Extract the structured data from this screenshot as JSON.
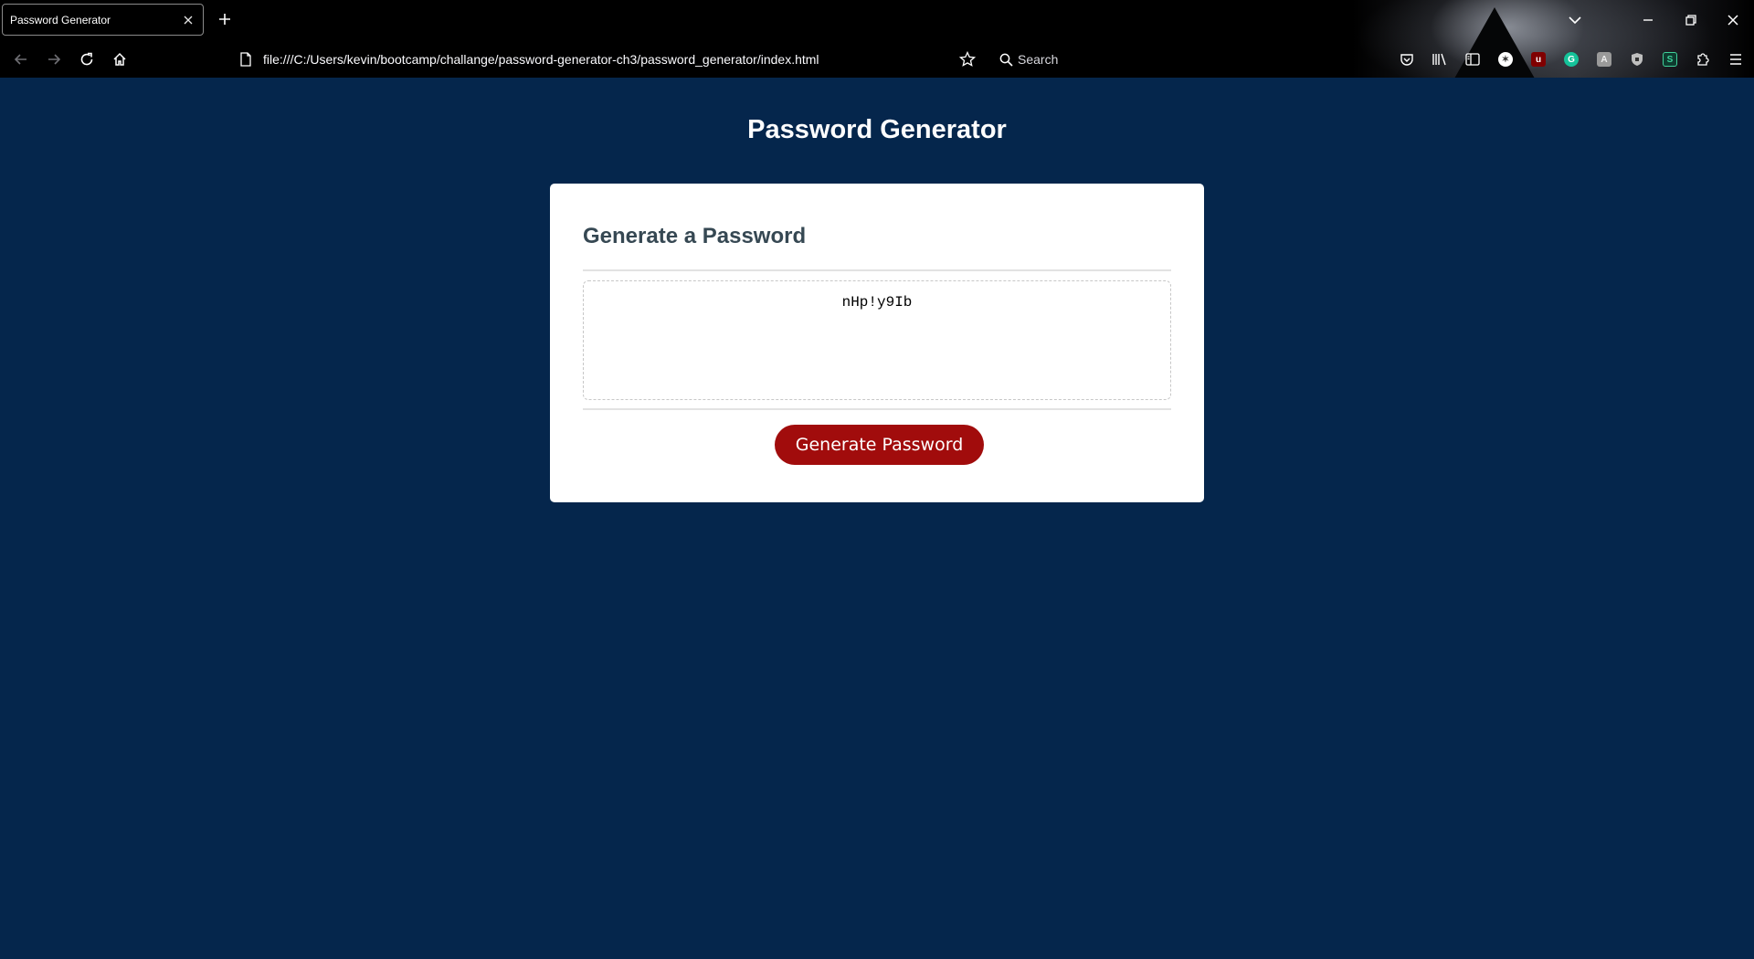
{
  "browser": {
    "tab": {
      "title": "Password Generator"
    },
    "url": "file:///C:/Users/kevin/bootcamp/challange/password-generator-ch3/password_generator/index.html",
    "search": {
      "placeholder": "Search"
    },
    "colors": {
      "chrome_bg": "#000000",
      "chrome_text": "#fbfbfe"
    },
    "icons": {
      "tab_close": "close-icon",
      "new_tab": "plus-icon",
      "list_tabs": "chevron-down-icon",
      "back": "arrow-left-icon",
      "forward": "arrow-right-icon",
      "reload": "reload-icon",
      "home": "home-icon",
      "page": "page-icon",
      "bookmark": "star-icon",
      "search": "search-icon",
      "toolbar": [
        "pocket-icon",
        "library-icon",
        "sidebar-icon",
        "extension-icon",
        "ublock-icon",
        "grammarly-icon",
        "extension-icon",
        "shield-icon",
        "extension-icon",
        "puzzle-icon",
        "menu-icon"
      ],
      "window": [
        "minimize-icon",
        "restore-icon",
        "close-icon"
      ]
    }
  },
  "page": {
    "title": "Password Generator",
    "card": {
      "header": "Generate a Password",
      "password": "nHp!y9Ib",
      "button_label": "Generate Password"
    },
    "colors": {
      "background": "#05264c",
      "card": "#ffffff",
      "header_text": "#364853",
      "button": "#a10c0c",
      "button_text": "#ffffff"
    }
  }
}
